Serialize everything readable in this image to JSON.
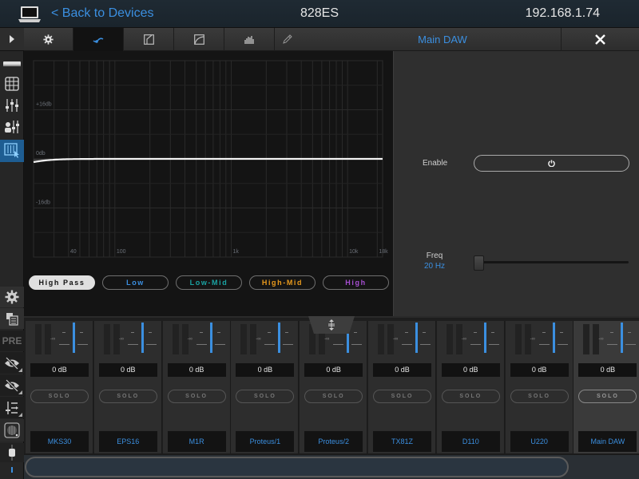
{
  "header": {
    "back_label": "< Back to Devices",
    "device_name": "828ES",
    "ip_address": "192.168.1.74"
  },
  "tabs": [
    {
      "icon": "gear-icon",
      "active": false
    },
    {
      "icon": "eq-curve-icon",
      "active": true
    },
    {
      "icon": "gate-icon",
      "active": false
    },
    {
      "icon": "compressor-icon",
      "active": false
    },
    {
      "icon": "spectrum-icon",
      "active": false
    },
    {
      "icon": "pencil-icon",
      "active": false
    }
  ],
  "tab_title": "Main DAW",
  "close_icon": "close-icon",
  "rail": {
    "items": [
      {
        "icon": "device-icon"
      },
      {
        "icon": "routing-grid-icon"
      },
      {
        "icon": "mixer-faders-icon"
      },
      {
        "icon": "channel-faders-icon"
      },
      {
        "icon": "eq-touch-icon",
        "active": true
      }
    ],
    "bottom_items": [
      {
        "icon": "settings-gear-icon"
      },
      {
        "icon": "copy-list-icon"
      },
      {
        "icon": "pre-label",
        "label": "PRE"
      },
      {
        "icon": "hide-eye-icon"
      },
      {
        "icon": "hide-eye-icon"
      },
      {
        "icon": "list-arrow-icon"
      },
      {
        "icon": "meter-view-icon"
      },
      {
        "icon": "fader-handle-icon"
      }
    ]
  },
  "eq": {
    "y_labels": [
      "+16db",
      "0db",
      "-16db"
    ],
    "x_labels": [
      "40",
      "100",
      "1k",
      "10k",
      "18k"
    ],
    "curve_type": "high-pass",
    "bands": [
      {
        "label": "High Pass",
        "color": "#111111",
        "selected": true
      },
      {
        "label": "Low",
        "color": "#3b8fe0",
        "selected": false
      },
      {
        "label": "Low-Mid",
        "color": "#1aa3a3",
        "selected": false
      },
      {
        "label": "High-Mid",
        "color": "#e99a1c",
        "selected": false
      },
      {
        "label": "High",
        "color": "#a64ed1",
        "selected": false
      }
    ]
  },
  "params": {
    "enable_label": "Enable",
    "enable_icon": "power-icon",
    "freq_label": "Freq",
    "freq_value": "20 Hz",
    "freq_fraction": 0.0
  },
  "mixer": {
    "inf_label": "-∞",
    "solo_label": "SOLO",
    "channels": [
      {
        "name": "MKS30",
        "level": "0 dB"
      },
      {
        "name": "EPS16",
        "level": "0 dB"
      },
      {
        "name": "M1R",
        "level": "0 dB"
      },
      {
        "name": "Proteus/1",
        "level": "0 dB"
      },
      {
        "name": "Proteus/2",
        "level": "0 dB"
      },
      {
        "name": "TX81Z",
        "level": "0 dB"
      },
      {
        "name": "D110",
        "level": "0 dB"
      },
      {
        "name": "U220",
        "level": "0 dB"
      },
      {
        "name": "Main DAW",
        "level": "0 dB",
        "selected": true
      }
    ]
  },
  "scrollbar": {
    "position_fraction": 0.0,
    "visible_fraction": 0.89
  }
}
